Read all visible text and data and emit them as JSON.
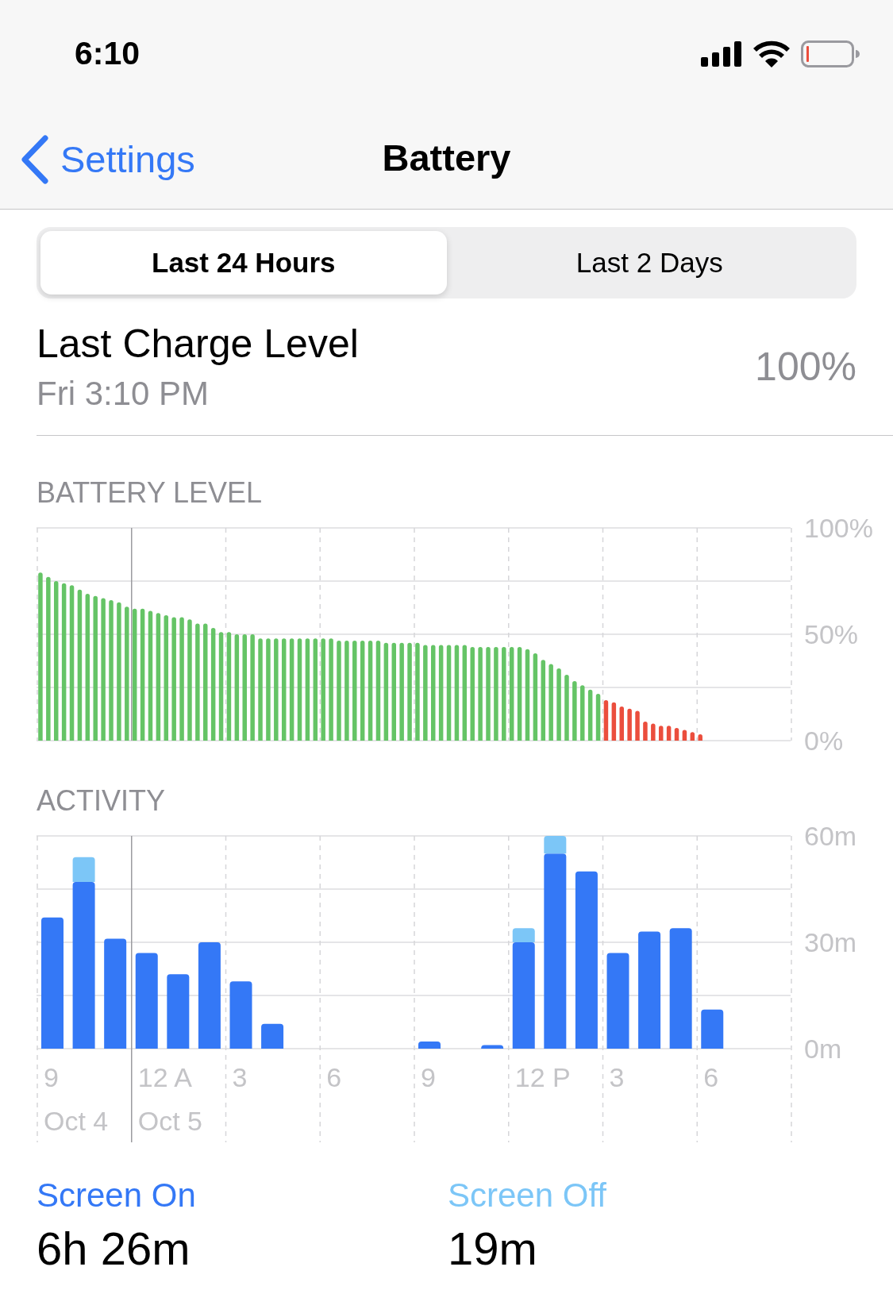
{
  "status_bar": {
    "time": "6:10"
  },
  "nav": {
    "back": "Settings",
    "title": "Battery"
  },
  "segments": [
    {
      "label": "Last 24 Hours",
      "selected": true
    },
    {
      "label": "Last 2 Days",
      "selected": false
    }
  ],
  "last_charge": {
    "label": "Last Charge Level",
    "time": "Fri 3:10 PM",
    "value": "100%"
  },
  "battery_level": {
    "chart_data": {
      "type": "bar",
      "title": "BATTERY LEVEL",
      "ylim": [
        0,
        100
      ],
      "yticks": [
        {
          "value": 0,
          "label": "0%"
        },
        {
          "value": 50,
          "label": "50%"
        },
        {
          "value": 100,
          "label": "100%"
        }
      ],
      "series": [
        {
          "color": "#65c466",
          "values": [
            79,
            77,
            75,
            74,
            73,
            71,
            69,
            68,
            67,
            66,
            65,
            63,
            62,
            62,
            61,
            60,
            59,
            58,
            58,
            57,
            55,
            55,
            53,
            51,
            51,
            50,
            50,
            50,
            48,
            48,
            48,
            48,
            48,
            48,
            48,
            48,
            48,
            48,
            47,
            47,
            47,
            47,
            47,
            47,
            46,
            46,
            46,
            46,
            46,
            45,
            45,
            45,
            45,
            45,
            45,
            44,
            44,
            44,
            44,
            44,
            44,
            44,
            43,
            41,
            38,
            36,
            34,
            31,
            28,
            26,
            24,
            22,
            null,
            null,
            null,
            null,
            null,
            null,
            null,
            null,
            null,
            null,
            null,
            null,
            null,
            null,
            null,
            null,
            null,
            null,
            null,
            null,
            null,
            null,
            null,
            null
          ]
        },
        {
          "color": "#eb4e3d",
          "values": [
            null,
            null,
            null,
            null,
            null,
            null,
            null,
            null,
            null,
            null,
            null,
            null,
            null,
            null,
            null,
            null,
            null,
            null,
            null,
            null,
            null,
            null,
            null,
            null,
            null,
            null,
            null,
            null,
            null,
            null,
            null,
            null,
            null,
            null,
            null,
            null,
            null,
            null,
            null,
            null,
            null,
            null,
            null,
            null,
            null,
            null,
            null,
            null,
            null,
            null,
            null,
            null,
            null,
            null,
            null,
            null,
            null,
            null,
            null,
            null,
            null,
            null,
            null,
            null,
            null,
            null,
            null,
            null,
            null,
            null,
            null,
            null,
            19,
            18,
            16,
            15,
            14,
            9,
            8,
            7,
            7,
            6,
            5,
            4,
            3,
            null,
            null,
            null,
            null,
            null,
            null,
            null,
            null,
            null,
            null,
            null
          ]
        }
      ]
    }
  },
  "activity": {
    "chart_data": {
      "type": "bar",
      "title": "ACTIVITY",
      "ylim": [
        0,
        60
      ],
      "yticks": [
        {
          "value": 0,
          "label": "0m"
        },
        {
          "value": 30,
          "label": "30m"
        },
        {
          "value": 60,
          "label": "60m"
        }
      ],
      "categories": [
        "9",
        null,
        null,
        "12 A",
        null,
        null,
        "3",
        null,
        null,
        "6",
        null,
        null,
        "9",
        null,
        null,
        "12 P",
        null,
        null,
        "3",
        null,
        null,
        "6",
        null,
        null
      ],
      "annotations": [
        "Oct 4",
        "Oct 5"
      ],
      "stacked": true,
      "series": [
        {
          "name": "Screen On",
          "color": "#3478f6",
          "values": [
            37,
            47,
            31,
            27,
            21,
            30,
            19,
            7,
            0,
            0,
            0,
            0,
            2,
            0,
            1,
            30,
            55,
            50,
            27,
            33,
            34,
            11,
            0,
            0
          ]
        },
        {
          "name": "Screen Off",
          "color": "#7cc6f7",
          "values": [
            0,
            7,
            0,
            0,
            0,
            0,
            0,
            0,
            0,
            0,
            0,
            0,
            0,
            0,
            0,
            4,
            5,
            0,
            0,
            0,
            0,
            0,
            0,
            0
          ]
        }
      ]
    }
  },
  "summary": [
    {
      "value": "6h 26m"
    },
    {
      "value": "19m"
    }
  ]
}
